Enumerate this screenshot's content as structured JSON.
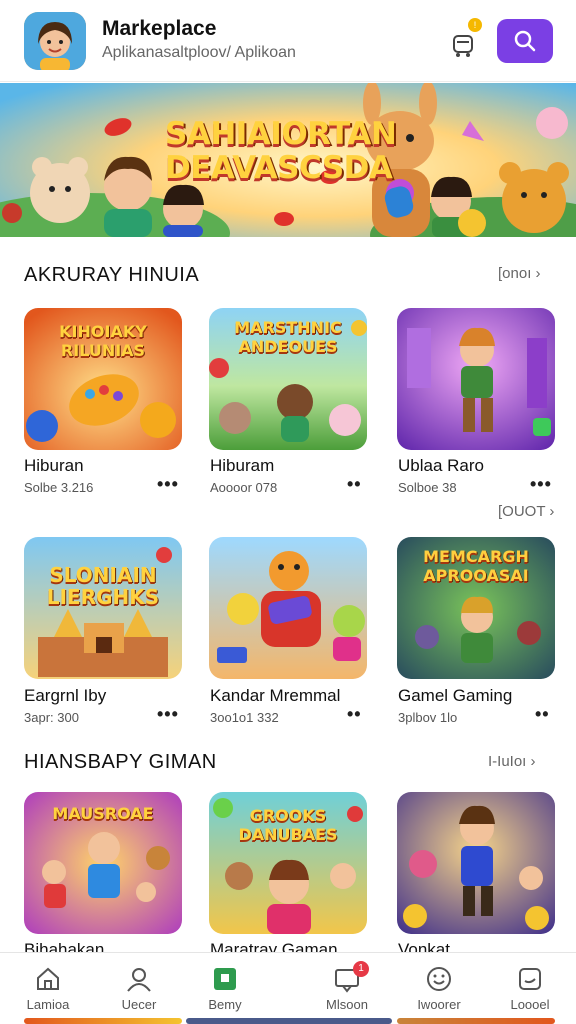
{
  "header": {
    "title": "Markeplace",
    "subtitle": "Aplikanasaltploov/ Aplikoan",
    "cart_badge": "!",
    "icons": {
      "avatar": "app-avatar-icon",
      "cart": "cart-icon",
      "search": "search-icon"
    },
    "colors": {
      "accent": "#7b3fe4",
      "badge": "#f5b800"
    }
  },
  "banner": {
    "title_line1": "SAHIAIORTAN",
    "title_line2": "DEAVASCSDA"
  },
  "sections": [
    {
      "title": "AKRURAY HINUIA",
      "more": "[onoı",
      "items": [
        {
          "tile_text": "KIHOIAKY RILUNIAS",
          "name": "Hiburan",
          "meta": "Solbe 3.216",
          "theme": "orange"
        },
        {
          "tile_text": "MARSTHNIC ANDEOUES",
          "name": "Hiburam",
          "meta": "Aoooor 078",
          "theme": "forest"
        },
        {
          "tile_text": "",
          "name": "Ublaa Raro",
          "meta": "Solboe 38",
          "theme": "purple"
        }
      ]
    },
    {
      "title": "",
      "more": "[OUOT",
      "items": [
        {
          "tile_text": "SLONIAIN LIERGHKS",
          "name": "Eargrnl Iby",
          "meta": "3apr: 300",
          "theme": "sky"
        },
        {
          "tile_text": "",
          "name": "Kandar Mremmal",
          "meta": "3oo1o1 332",
          "theme": "toys"
        },
        {
          "tile_text": "MEMCARGH APROOASAI",
          "name": "Gamel Gaming",
          "meta": "3plbov 1lo",
          "theme": "night"
        }
      ]
    },
    {
      "title": "HIANSBAPY GIMAN",
      "more": "I-IuIoı",
      "items": [
        {
          "tile_text": "MAUSROAE",
          "name": "Bihahakan",
          "meta": "",
          "theme": "magenta"
        },
        {
          "tile_text": "GROOKS DANUBAES",
          "name": "Maratray Gaman",
          "meta": "",
          "theme": "teal"
        },
        {
          "tile_text": "",
          "name": "Vonkat",
          "meta": "",
          "theme": "arena"
        }
      ]
    }
  ],
  "bottom_nav": {
    "items": [
      {
        "label": "Lamioa",
        "icon": "home-icon"
      },
      {
        "label": "Uecer",
        "icon": "user-icon"
      },
      {
        "label": "Bemy",
        "icon": "store-icon"
      },
      {
        "label": "Mlsoon",
        "icon": "message-icon",
        "badge": "1"
      },
      {
        "label": "Iwoorer",
        "icon": "smiley-icon"
      },
      {
        "label": "Loooel",
        "icon": "chat-icon"
      }
    ],
    "active_color": "#2e9b4e"
  }
}
